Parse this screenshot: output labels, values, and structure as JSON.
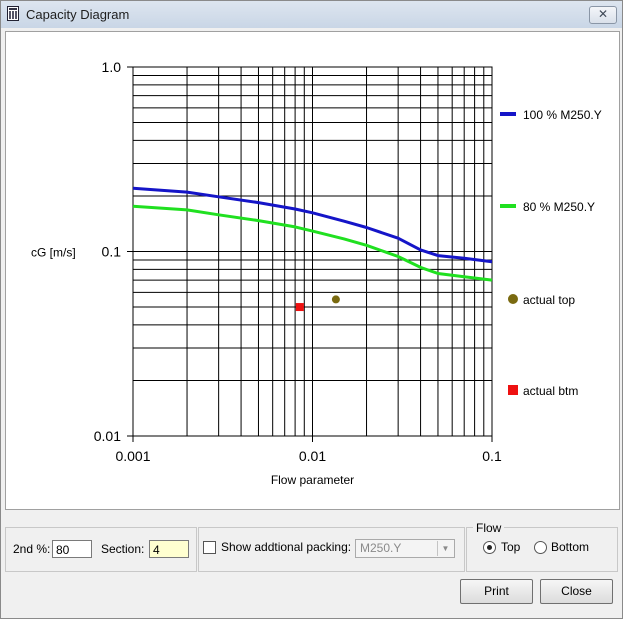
{
  "window": {
    "title": "Capacity Diagram",
    "close_glyph": "✕",
    "app_icon": "app-icon"
  },
  "chart_data": {
    "type": "line",
    "xlabel": "Flow parameter",
    "ylabel": "cG [m/s]",
    "x_scale": "log",
    "y_scale": "log",
    "xlim": [
      0.001,
      0.1
    ],
    "ylim": [
      0.01,
      1.0
    ],
    "x_ticks": [
      "0.001",
      "0.01",
      "0.1"
    ],
    "y_ticks": [
      "1.0",
      "0.1",
      "0.01"
    ],
    "grid": true,
    "legend_position": "right",
    "series": [
      {
        "name": "100 % M250.Y",
        "color": "#1515c8",
        "x": [
          0.001,
          0.002,
          0.003,
          0.005,
          0.008,
          0.01,
          0.015,
          0.02,
          0.03,
          0.04,
          0.05,
          0.07,
          0.1
        ],
        "y": [
          0.22,
          0.21,
          0.198,
          0.184,
          0.17,
          0.162,
          0.146,
          0.135,
          0.118,
          0.102,
          0.095,
          0.092,
          0.088
        ]
      },
      {
        "name": "80 % M250.Y",
        "color": "#20e020",
        "x": [
          0.001,
          0.002,
          0.003,
          0.005,
          0.008,
          0.01,
          0.015,
          0.02,
          0.03,
          0.04,
          0.05,
          0.07,
          0.1
        ],
        "y": [
          0.176,
          0.168,
          0.158,
          0.147,
          0.136,
          0.129,
          0.117,
          0.108,
          0.094,
          0.082,
          0.076,
          0.073,
          0.07
        ]
      }
    ],
    "points": [
      {
        "name": "actual top",
        "color": "#7a6a10",
        "marker": "circle",
        "x": 0.0135,
        "y": 0.055
      },
      {
        "name": "actual btm",
        "color": "#ee1111",
        "marker": "square",
        "x": 0.0085,
        "y": 0.05
      }
    ]
  },
  "controls": {
    "second_pct_label": "2nd %:",
    "second_pct_value": "80",
    "section_label": "Section:",
    "section_value": "4",
    "show_packing_label": "Show addtional packing:",
    "show_packing_checked": false,
    "packing_select": "M250.Y",
    "flow_title": "Flow",
    "flow_top": "Top",
    "flow_bottom": "Bottom",
    "flow_selected": "Top",
    "print_label": "Print",
    "close_label": "Close"
  }
}
